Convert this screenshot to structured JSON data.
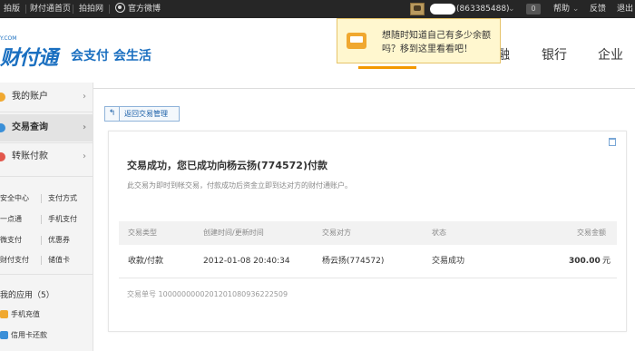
{
  "topbar": {
    "links": [
      "拍版",
      "财付通首页",
      "拍拍网",
      "官方微博"
    ],
    "account_id": "(863385488)",
    "message_count": "0",
    "help": "帮助",
    "feedback": "反馈",
    "logout": "退出"
  },
  "header": {
    "logo_url": "Y.COM",
    "logo_text": "财付通",
    "slogan": "会支付 会生活",
    "nav": [
      "融",
      "银行",
      "企业"
    ]
  },
  "tooltip": {
    "line1": "想随时知道自己有多少余额",
    "line2": "吗？移到这里看看吧！"
  },
  "sidebar": {
    "items": [
      {
        "label": "我的账户",
        "chevron": "›"
      },
      {
        "label": "交易查询",
        "chevron": "›"
      },
      {
        "label": "转账付款",
        "chevron": "›"
      }
    ],
    "grid": [
      [
        "安全中心",
        "支付方式"
      ],
      [
        "一点通",
        "手机支付"
      ],
      [
        "微支付",
        "优惠券"
      ],
      [
        "财付支付",
        "储值卡"
      ]
    ],
    "apps_title": "我的应用（5）",
    "apps": [
      "手机充值",
      "信用卡还款"
    ]
  },
  "main": {
    "back_label": "返回交易管理",
    "success_title": "交易成功，您已成功向杨云扬(774572)付款",
    "success_sub": "此交易为即时到帐交易，付款成功后资金立即到达对方的财付通账户。",
    "table": {
      "headers": [
        "交易类型",
        "创建时间/更新时间",
        "交易对方",
        "状态",
        "交易金额"
      ],
      "row": [
        "收款/付款",
        "2012-01-08 20:40:34",
        "杨云扬(774572)",
        "交易成功",
        "300.00",
        "元"
      ]
    },
    "txn_label": "交易单号",
    "txn_number": "1000000000201201080936222509"
  }
}
